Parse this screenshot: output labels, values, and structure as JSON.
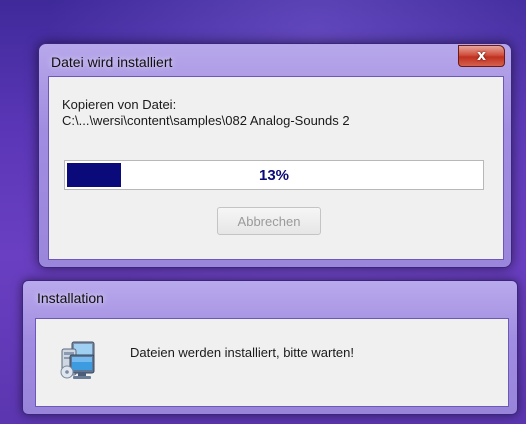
{
  "copy_dialog": {
    "title": "Datei wird installiert",
    "close_symbol": "x",
    "copy_label": "Kopieren von Datei:",
    "copy_path": "C:\\...\\wersi\\content\\samples\\082 Analog-Sounds 2",
    "progress_fraction": 0.13,
    "progress_text": "13%",
    "cancel_label": "Abbrechen",
    "cancel_enabled": false,
    "progress_color": "#0a0a7a"
  },
  "install_dialog": {
    "title": "Installation",
    "message": "Dateien werden installiert, bitte warten!",
    "icon": "computer-setup-icon"
  },
  "colors": {
    "desktop": "#5a36b6",
    "window_frame": "#a08ce0",
    "close_button": "#c0301f"
  }
}
